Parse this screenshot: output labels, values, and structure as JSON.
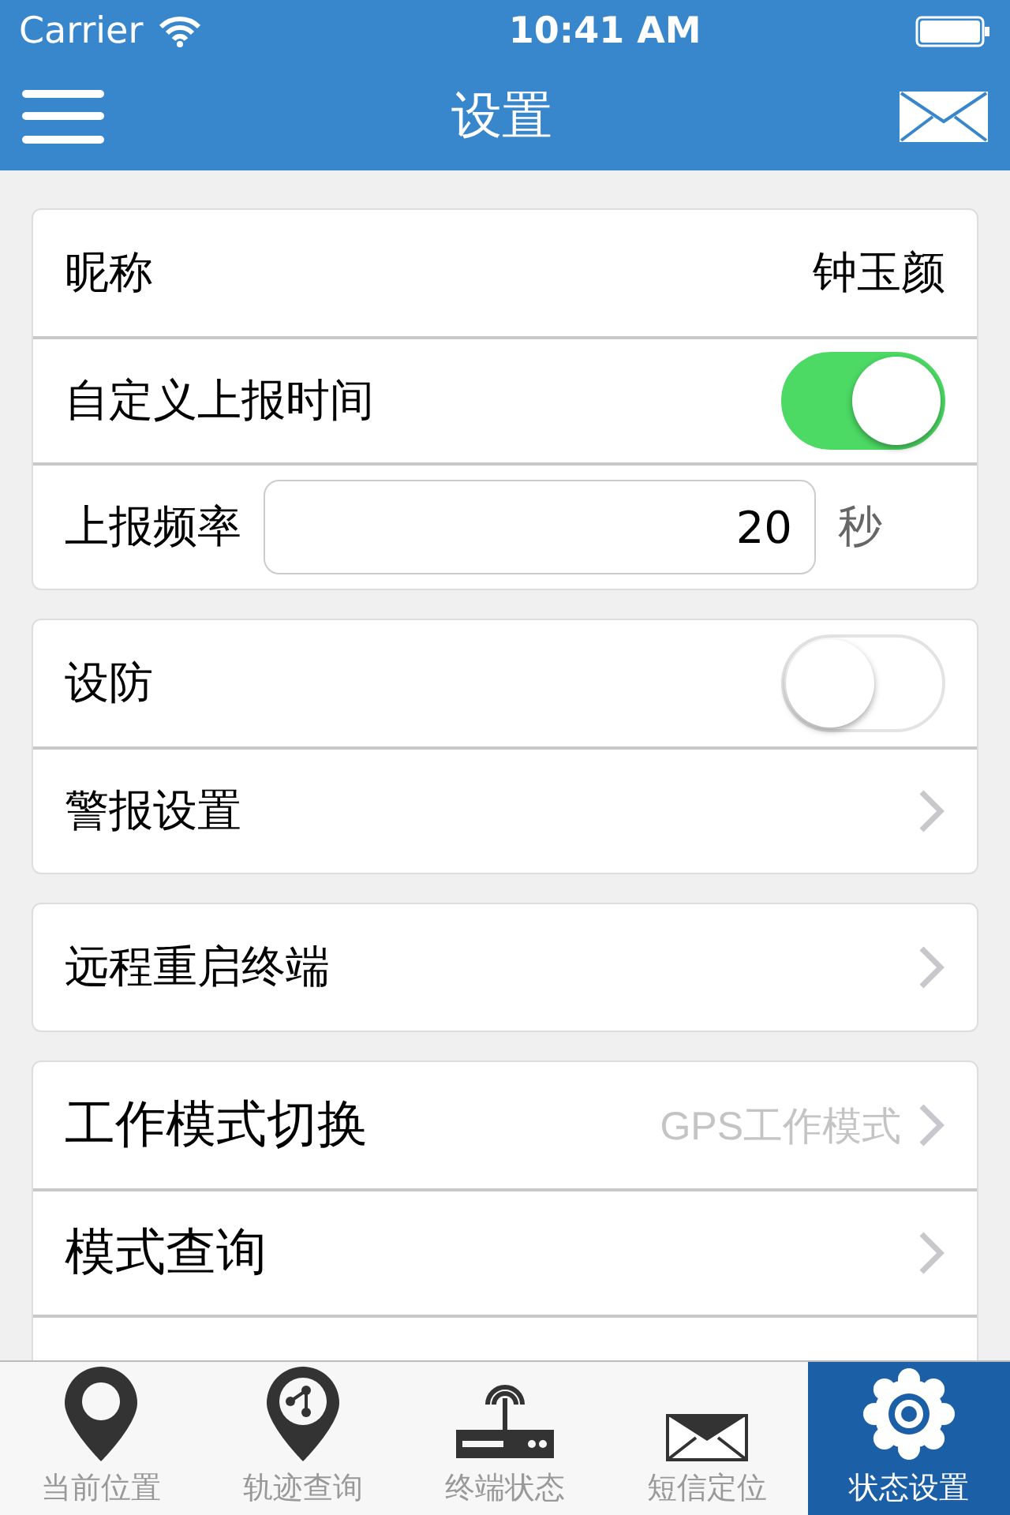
{
  "status_bar": {
    "carrier": "Carrier",
    "time": "10:41 AM"
  },
  "nav": {
    "title": "设置"
  },
  "groups": [
    {
      "rows": [
        {
          "kind": "value",
          "label": "昵称",
          "value": "钟玉颜"
        },
        {
          "kind": "toggle",
          "label": "自定义上报时间",
          "on": true
        },
        {
          "kind": "input",
          "label": "上报频率",
          "value": "20",
          "unit": "秒"
        }
      ]
    },
    {
      "rows": [
        {
          "kind": "toggle",
          "label": "设防",
          "on": false
        },
        {
          "kind": "link",
          "label": "警报设置"
        }
      ]
    },
    {
      "rows": [
        {
          "kind": "link",
          "label": "远程重启终端"
        }
      ]
    },
    {
      "rows": [
        {
          "kind": "link",
          "label": "工作模式切换",
          "value": "GPS工作模式"
        },
        {
          "kind": "link",
          "label": "模式查询"
        },
        {
          "kind": "hidden"
        }
      ]
    }
  ],
  "tabs": [
    {
      "kind": "pin",
      "label": "当前位置",
      "selected": false
    },
    {
      "kind": "route",
      "label": "轨迹查询",
      "selected": false
    },
    {
      "kind": "router",
      "label": "终端状态",
      "selected": false
    },
    {
      "kind": "mail",
      "label": "短信定位",
      "selected": false
    },
    {
      "kind": "gear",
      "label": "状态设置",
      "selected": true
    }
  ]
}
